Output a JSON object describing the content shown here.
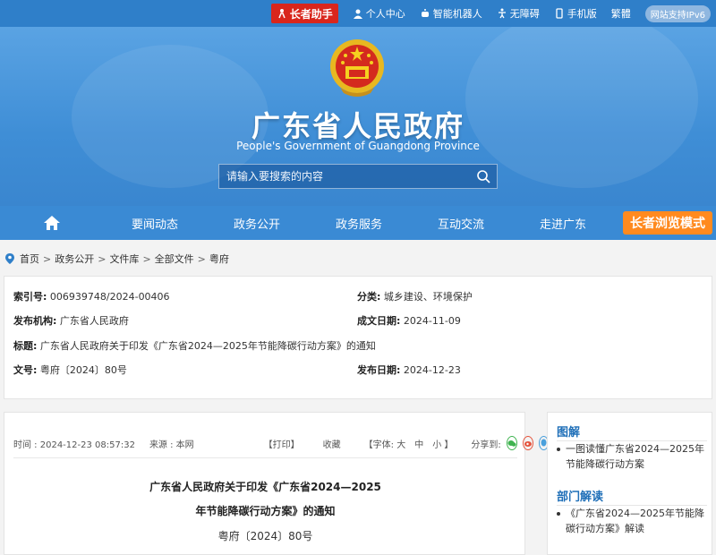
{
  "topbar": {
    "elder_helper": "长者助手",
    "personal_center": "个人中心",
    "smart_robot": "智能机器人",
    "accessibility": "无障碍",
    "mobile": "手机版",
    "traditional": "繁體",
    "ipv6": "网站支持IPv6"
  },
  "header": {
    "title": "广东省人民政府",
    "subtitle": "People's Government of Guangdong Province",
    "search_placeholder": "请输入要搜索的内容"
  },
  "nav": {
    "items": [
      "要闻动态",
      "政务公开",
      "政务服务",
      "互动交流",
      "走进广东"
    ],
    "elder_mode": "长者浏览模式"
  },
  "breadcrumb": [
    "首页",
    "政务公开",
    "文件库",
    "全部文件",
    "粤府"
  ],
  "info": {
    "index_label": "索引号:",
    "index_value": "006939748/2024-00406",
    "category_label": "分类:",
    "category_value": "城乡建设、环境保护",
    "issuer_label": "发布机构:",
    "issuer_value": "广东省人民政府",
    "date_written_label": "成文日期:",
    "date_written_value": "2024-11-09",
    "title_label": "标题:",
    "title_value": "广东省人民政府关于印发《广东省2024—2025年节能降碳行动方案》的通知",
    "doc_no_label": "文号:",
    "doc_no_value": "粤府〔2024〕80号",
    "pub_date_label": "发布日期:",
    "pub_date_value": "2024-12-23"
  },
  "article": {
    "time": "时间 : 2024-12-23 08:57:32",
    "source": "来源 : 本网",
    "print": "【打印】",
    "favorite": "收藏",
    "font_label": "【字体: 大",
    "font_mid": "中",
    "font_small": "小 】",
    "share_label": "分享到:",
    "title_line1": "广东省人民政府关于印发《广东省2024—2025",
    "title_line2": "年节能降碳行动方案》的通知",
    "doc_no": "粤府〔2024〕80号"
  },
  "sidebar": {
    "section1_title": "图解",
    "section1_item": "一图读懂广东省2024—2025年节能降碳行动方案",
    "section2_title": "部门解读",
    "section2_item": "《广东省2024—2025年节能降碳行动方案》解读"
  },
  "colors": {
    "primary_blue": "#3a8ad4",
    "elder_red": "#d9261c",
    "elder_orange": "#ff8a1f",
    "link_blue": "#1f6fb8"
  }
}
